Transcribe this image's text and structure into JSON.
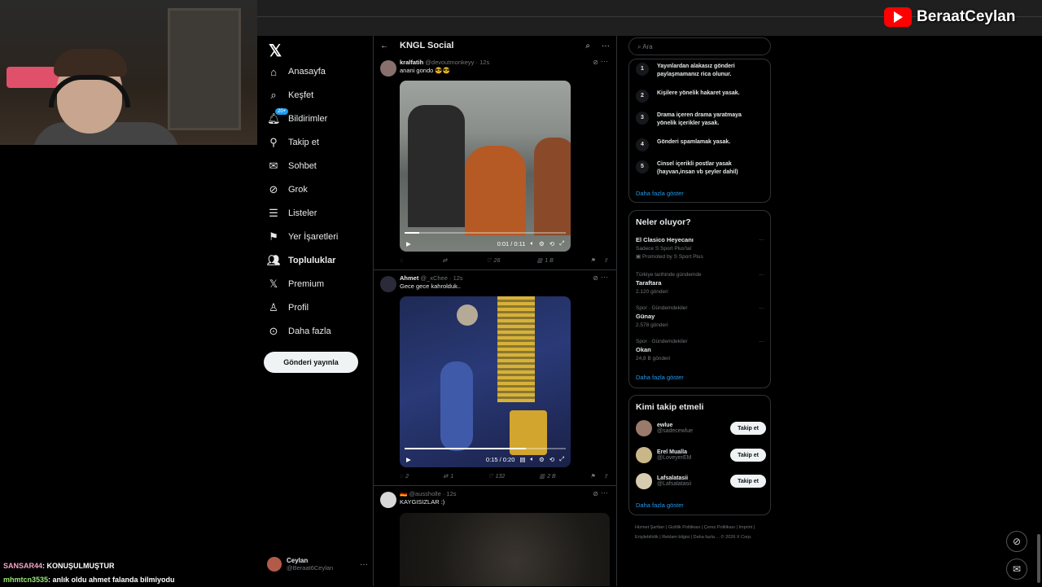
{
  "brand": {
    "channel": "BeraatCeylan",
    "icon": "youtube-icon"
  },
  "nav": {
    "logo": "𝕏",
    "items": [
      {
        "label": "Anasayfa",
        "icon": "home-icon"
      },
      {
        "label": "Keşfet",
        "icon": "search-icon"
      },
      {
        "label": "Bildirimler",
        "icon": "bell-icon",
        "badge": "20+"
      },
      {
        "label": "Takip et",
        "icon": "person-add-icon"
      },
      {
        "label": "Sohbet",
        "icon": "mail-icon"
      },
      {
        "label": "Grok",
        "icon": "grok-icon"
      },
      {
        "label": "Listeler",
        "icon": "list-icon"
      },
      {
        "label": "Yer İşaretleri",
        "icon": "bookmark-icon"
      },
      {
        "label": "Topluluklar",
        "icon": "communities-icon"
      },
      {
        "label": "Premium",
        "icon": "x-icon"
      },
      {
        "label": "Profil",
        "icon": "person-icon"
      },
      {
        "label": "Daha fazla",
        "icon": "more-circle-icon"
      }
    ],
    "post_button": "Gönderi yayınla",
    "account": {
      "name": "Ceylan",
      "handle": "@Beraat6Ceylan"
    }
  },
  "timeline": {
    "title": "KNGL Social",
    "posts": [
      {
        "name": "kralfatih",
        "handle": "@devoutmonkeyy",
        "time": "12s",
        "text": "anani gondo 😎😎",
        "video_time": "0:01 / 0:11",
        "progress": 0.09,
        "replies": "",
        "reposts": "",
        "likes": "26",
        "views": "1 B"
      },
      {
        "name": "Ahmet",
        "handle": "@_xChee",
        "time": "12s",
        "text": "Gece gece kahrolduk..",
        "video_time": "0:15 / 0:20",
        "progress": 0.75,
        "replies": "2",
        "reposts": "1",
        "likes": "132",
        "views": "2 B"
      },
      {
        "name": "🇩🇪",
        "handle": "@aussholle",
        "time": "12s",
        "text": "KAYGISIZLAR :)"
      }
    ]
  },
  "right": {
    "search_placeholder": "Ara",
    "rules": [
      {
        "num": "1",
        "text": "Yayınlardan alakasız gönderi paylaşmamanız rica olunur."
      },
      {
        "num": "2",
        "text": "Kişilere yönelik hakaret yasak."
      },
      {
        "num": "3",
        "text": "Drama içeren drama yaratmaya yönelik içerikler yasak."
      },
      {
        "num": "4",
        "text": "Gönderi spamlamak yasak."
      },
      {
        "num": "5",
        "text": "Cinsel içerikli postlar yasak (hayvan,insan vb şeyler dahil)"
      }
    ],
    "show_more": "Daha fazla göster",
    "trends_title": "Neler oluyor?",
    "trends": [
      {
        "context": "",
        "name": "El Clasico Heyecanı",
        "sub": "Sadece S Sport Plus'tal",
        "meta": "Promoted by S Sport Plus"
      },
      {
        "context": "Türkiye tarihinde gündemde",
        "name": "Taraftara",
        "sub": "",
        "meta": "2.120 gönderi"
      },
      {
        "context": "Spor · Gündemdekiler",
        "name": "Günay",
        "sub": "",
        "meta": "2.578 gönderi"
      },
      {
        "context": "Spor · Gündemdekiler",
        "name": "Okan",
        "sub": "",
        "meta": "24,8 B gönderi"
      }
    ],
    "who_title": "Kimi takip etmeli",
    "who": [
      {
        "name": "ewlue",
        "handle": "@sadecewlue",
        "button": "Takip et"
      },
      {
        "name": "Erel Mualla",
        "handle": "@LoveyerEM",
        "button": "Takip et"
      },
      {
        "name": "Lafsalatasii",
        "handle": "@Lafsalatasii",
        "button": "Takip et"
      }
    ],
    "footer": "Hizmet Şartları | Gizlilik Politikası | Çerez Politikası | Imprint | Erişilebilirlik | Reklam bilgisi | Daha fazla ... © 2026 X Corp."
  },
  "chat": [
    {
      "user": "SANSAR44",
      "message": ": KONUŞULMUŞTUR"
    },
    {
      "user": "mhmtcn3535",
      "message": ": anlık oldu ahmet falanda bilmiyodu"
    }
  ],
  "colors": {
    "accent": "#1d9bf0",
    "background": "#000000",
    "border": "#2f3336"
  }
}
